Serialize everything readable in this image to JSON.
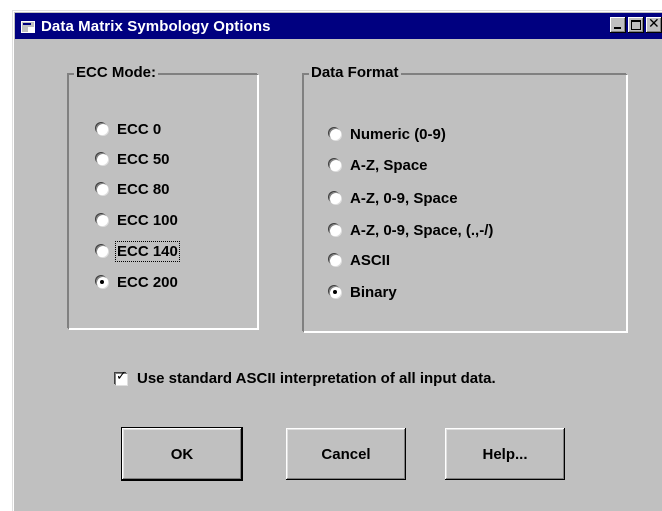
{
  "window": {
    "title": "Data Matrix Symbology Options"
  },
  "ecc_mode": {
    "legend": "ECC Mode:",
    "options": [
      {
        "label": "ECC 0",
        "selected": false
      },
      {
        "label": "ECC 50",
        "selected": false
      },
      {
        "label": "ECC 80",
        "selected": false
      },
      {
        "label": "ECC 100",
        "selected": false
      },
      {
        "label": "ECC 140",
        "selected": false
      },
      {
        "label": "ECC 200",
        "selected": true
      }
    ]
  },
  "data_format": {
    "legend": "Data Format",
    "options": [
      {
        "label": "Numeric (0-9)",
        "selected": false
      },
      {
        "label": "A-Z, Space",
        "selected": false
      },
      {
        "label": "A-Z, 0-9, Space",
        "selected": false
      },
      {
        "label": "A-Z, 0-9, Space, (.,-/)",
        "selected": false
      },
      {
        "label": "ASCII",
        "selected": false
      },
      {
        "label": "Binary",
        "selected": true
      }
    ]
  },
  "ascii_option": {
    "label": "Use standard ASCII interpretation of all input data.",
    "checked": true
  },
  "buttons": {
    "ok": "OK",
    "cancel": "Cancel",
    "help": "Help..."
  }
}
